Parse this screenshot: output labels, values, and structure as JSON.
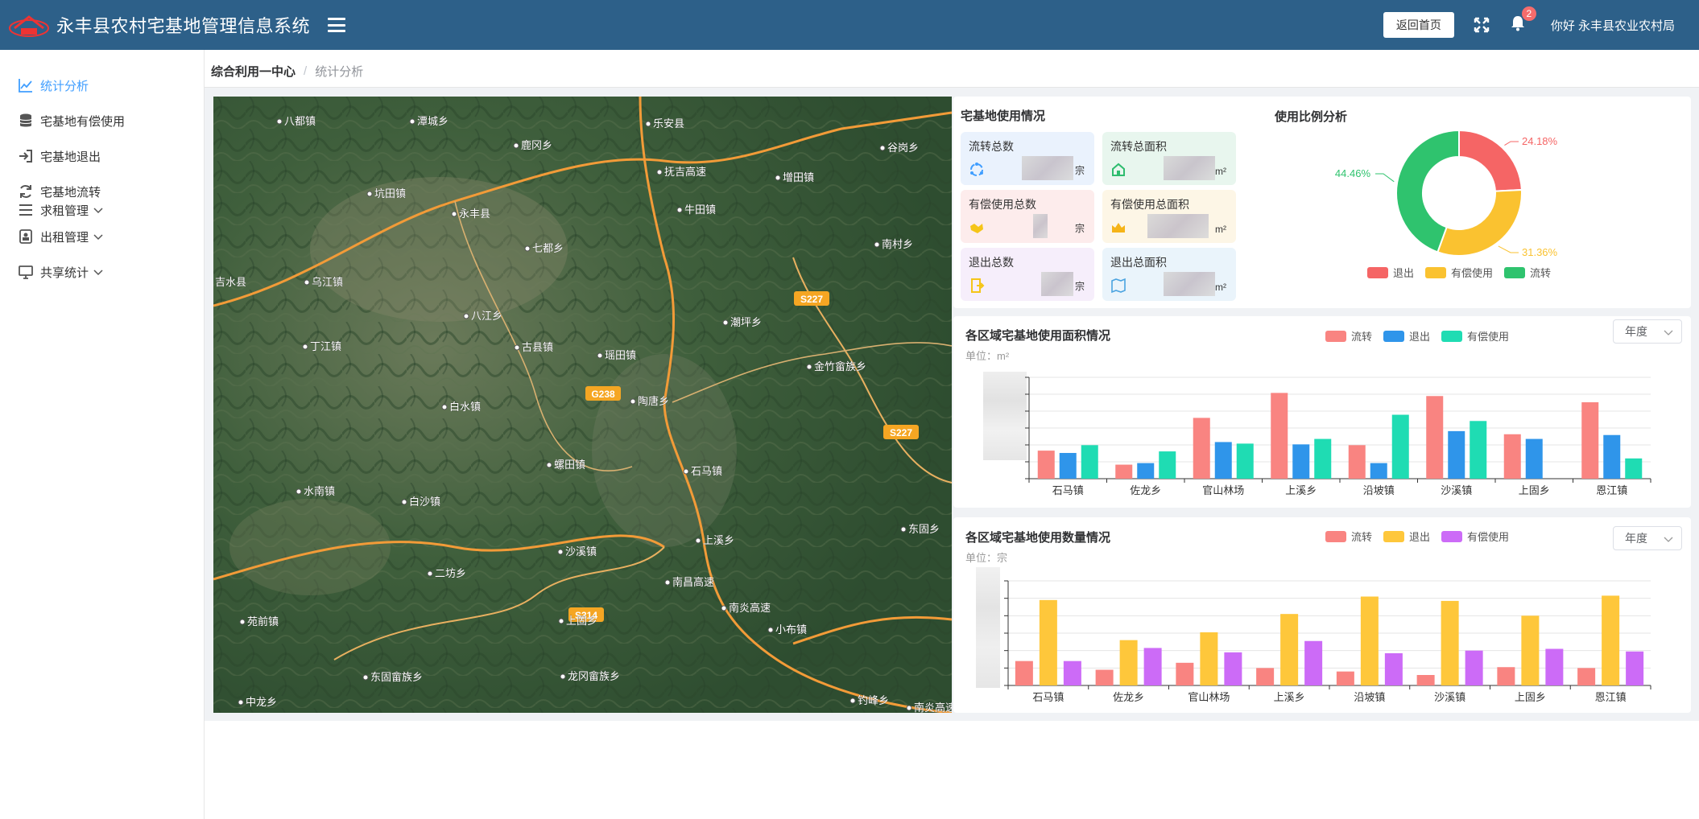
{
  "header": {
    "title": "永丰县农村宅基地管理信息系统",
    "home_button": "返回首页",
    "notification_count": "2",
    "greeting": "你好 永丰县农业农村局"
  },
  "sidebar": {
    "items": [
      {
        "label": "统计分析",
        "icon": "chart-line-icon",
        "active": true
      },
      {
        "label": "宅基地有偿使用",
        "icon": "database-icon"
      },
      {
        "label": "宅基地退出",
        "icon": "sign-in-icon"
      },
      {
        "label": "宅基地流转",
        "icon": "refresh-icon"
      },
      {
        "label": "求租管理",
        "icon": "list-icon",
        "expandable": true
      },
      {
        "label": "出租管理",
        "icon": "lock-icon",
        "expandable": true
      },
      {
        "label": "共享统计",
        "icon": "monitor-icon",
        "expandable": true
      }
    ]
  },
  "breadcrumb": {
    "level1": "综合利用一中心",
    "separator": "/",
    "level2": "统计分析"
  },
  "map": {
    "labels": [
      {
        "text": "八都镇"
      },
      {
        "text": "潭城乡"
      },
      {
        "text": "鹿冈乡"
      },
      {
        "text": "乐安县"
      },
      {
        "text": "谷岗乡"
      },
      {
        "text": "抚吉高速"
      },
      {
        "text": "坑田镇"
      },
      {
        "text": "永丰县"
      },
      {
        "text": "增田镇"
      },
      {
        "text": "牛田镇"
      },
      {
        "text": "南村乡"
      },
      {
        "text": "七都乡"
      },
      {
        "text": "吉水县"
      },
      {
        "text": "乌江镇"
      },
      {
        "text": "S227"
      },
      {
        "text": "八江乡"
      },
      {
        "text": "潮坪乡"
      },
      {
        "text": "丁江镇"
      },
      {
        "text": "古县镇"
      },
      {
        "text": "瑶田镇"
      },
      {
        "text": "金竹畲族乡"
      },
      {
        "text": "G238"
      },
      {
        "text": "白水镇"
      },
      {
        "text": "陶唐乡"
      },
      {
        "text": "S227"
      },
      {
        "text": "螺田镇"
      },
      {
        "text": "石马镇"
      },
      {
        "text": "水南镇"
      },
      {
        "text": "白沙镇"
      },
      {
        "text": "东固乡"
      },
      {
        "text": "沙溪镇"
      },
      {
        "text": "上溪乡"
      },
      {
        "text": "二坊乡"
      },
      {
        "text": "S314"
      },
      {
        "text": "苑前镇"
      },
      {
        "text": "上固乡"
      },
      {
        "text": "小布镇"
      },
      {
        "text": "东固畲族乡"
      },
      {
        "text": "龙冈畲族乡"
      },
      {
        "text": "中龙乡"
      },
      {
        "text": "钓峰乡"
      },
      {
        "text": "南炎高速"
      },
      {
        "text": "南昌高速"
      },
      {
        "text": "南炎高速"
      }
    ]
  },
  "usage": {
    "title": "宅基地使用情况",
    "stats": [
      {
        "label": "流转总数",
        "unit": "宗",
        "icon": "transfer-icon",
        "bg": "#eaf2fd",
        "icon_color": "#409eff"
      },
      {
        "label": "流转总面积",
        "unit": "m²",
        "icon": "house-icon",
        "bg": "#e8f6ee",
        "icon_color": "#2ebc6e"
      },
      {
        "label": "有偿使用总数",
        "unit": "宗",
        "icon": "handshake-icon",
        "bg": "#fdecec",
        "icon_color": "#f5c518"
      },
      {
        "label": "有偿使用总面积",
        "unit": "m²",
        "icon": "crown-icon",
        "bg": "#fdf6e6",
        "icon_color": "#f5b418"
      },
      {
        "label": "退出总数",
        "unit": "宗",
        "icon": "exit-icon",
        "bg": "#f6eefb",
        "icon_color": "#f5c518"
      },
      {
        "label": "退出总面积",
        "unit": "m²",
        "icon": "map-icon",
        "bg": "#eaf4fb",
        "icon_color": "#4aa3e0"
      }
    ]
  },
  "ratio": {
    "title": "使用比例分析",
    "slices": [
      {
        "name": "退出",
        "value": 24.18,
        "label": "24.18%",
        "color": "#f56565"
      },
      {
        "name": "有偿使用",
        "value": 31.36,
        "label": "31.36%",
        "color": "#fac230"
      },
      {
        "name": "流转",
        "value": 44.46,
        "label": "44.46%",
        "color": "#2fc36e"
      }
    ]
  },
  "area_chart": {
    "title": "各区域宅基地使用面积情况",
    "unit": "单位：m²",
    "select": "年度"
  },
  "count_chart": {
    "title": "各区域宅基地使用数量情况",
    "unit": "单位：宗",
    "select": "年度"
  },
  "chart_data": [
    {
      "type": "bar",
      "title": "各区域宅基地使用面积情况",
      "categories": [
        "石马镇",
        "佐龙乡",
        "官山林场",
        "上溪乡",
        "沿坡镇",
        "沙溪镇",
        "上固乡",
        "恩江镇"
      ],
      "series": [
        {
          "name": "流转",
          "color": "#f98481",
          "values": [
            36,
            18,
            78,
            110,
            43,
            106,
            57,
            98
          ]
        },
        {
          "name": "退出",
          "color": "#2f95ea",
          "values": [
            33,
            20,
            47,
            44,
            20,
            61,
            51,
            56
          ]
        },
        {
          "name": "有偿使用",
          "color": "#1fdcb3",
          "values": [
            43,
            35,
            45,
            51,
            82,
            74,
            0,
            26
          ]
        }
      ],
      "ylim": [
        0,
        130
      ]
    },
    {
      "type": "bar",
      "title": "各区域宅基地使用数量情况",
      "categories": [
        "石马镇",
        "佐龙乡",
        "官山林场",
        "上溪乡",
        "沿坡镇",
        "沙溪镇",
        "上固乡",
        "恩江镇"
      ],
      "series": [
        {
          "name": "流转",
          "color": "#f98481",
          "values": [
            28,
            18,
            26,
            20,
            16,
            12,
            21,
            20
          ]
        },
        {
          "name": "退出",
          "color": "#fec73b",
          "values": [
            98,
            52,
            61,
            82,
            102,
            97,
            80,
            103
          ]
        },
        {
          "name": "有偿使用",
          "color": "#cc6bf7",
          "values": [
            28,
            43,
            38,
            51,
            37,
            40,
            42,
            39
          ]
        }
      ],
      "ylim": [
        0,
        120
      ]
    }
  ]
}
